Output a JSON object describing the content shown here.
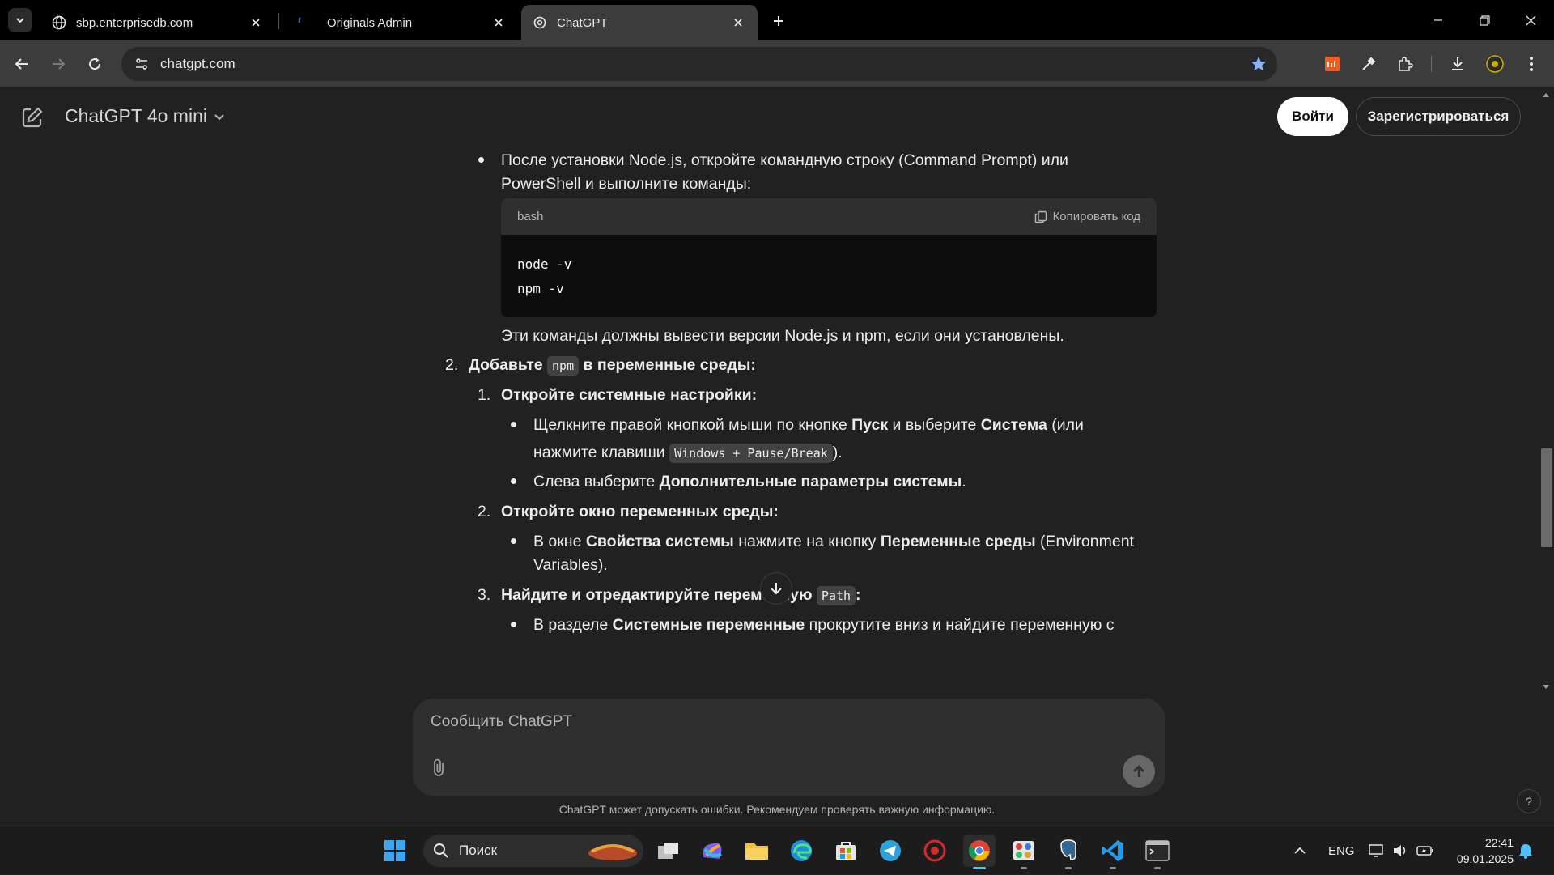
{
  "browser": {
    "tabs": [
      {
        "title": "sbp.enterprisedb.com",
        "active": false,
        "icon": "globe-icon"
      },
      {
        "title": "Originals Admin",
        "active": false,
        "icon": "page-icon"
      },
      {
        "title": "ChatGPT",
        "active": true,
        "icon": "openai-icon"
      }
    ],
    "url": "chatgpt.com"
  },
  "app": {
    "model_name": "ChatGPT 4o mini",
    "login_label": "Войти",
    "signup_label": "Зарегистрироваться",
    "composer_placeholder": "Сообщить ChatGPT",
    "disclaimer": "ChatGPT может допускать ошибки. Рекомендуем проверять важную информацию.",
    "help_label": "?"
  },
  "message": {
    "bullet_node_1": "После установки Node.js, откройте командную строку (Command Prompt) или",
    "bullet_node_2": "PowerShell и выполните команды:",
    "code": {
      "language": "bash",
      "copy_label": "Копировать код",
      "lines": [
        "node -v",
        "npm -v"
      ]
    },
    "after_code": "Эти команды должны вывести версии Node.js и npm, если они установлены.",
    "step2": {
      "num": "2.",
      "pre": "Добавьте",
      "code": "npm",
      "post": "в переменные среды:"
    },
    "sub1": {
      "num": "1.",
      "title": "Откройте системные настройки:"
    },
    "sub1_b1": {
      "t1": "Щелкните правой кнопкой мыши по кнопке ",
      "b1": "Пуск",
      "t2": " и выберите ",
      "b2": "Система",
      "t3": " (или",
      "t4": "нажмите клавиши ",
      "code": "Windows + Pause/Break",
      "t5": ")."
    },
    "sub1_b2": {
      "t1": "Слева выберите ",
      "b1": "Дополнительные параметры системы",
      "t2": "."
    },
    "sub2": {
      "num": "2.",
      "title": "Откройте окно переменных среды:"
    },
    "sub2_b1": {
      "t1": "В окне ",
      "b1": "Свойства системы",
      "t2": " нажмите на кнопку ",
      "b2": "Переменные среды",
      "t3": " (Environment",
      "t4": "Variables)."
    },
    "sub3": {
      "num": "3.",
      "title": "Найдите и отредактируйте переменную",
      "code": "Path",
      "colon": ":"
    },
    "sub3_b1": {
      "t1": "В разделе ",
      "b1": "Системные переменные",
      "t2": " прокрутите вниз и найдите переменную с"
    }
  },
  "taskbar": {
    "search_label": "Поиск",
    "lang": "ENG",
    "time": "22:41",
    "date": "09.01.2025",
    "apps": [
      "windows-start-icon",
      "task-view-icon",
      "copilot-icon",
      "file-explorer-icon",
      "edge-icon",
      "store-icon",
      "telegram-icon",
      "antivirus-icon",
      "chrome-icon",
      "paint-icon",
      "pgadmin-icon",
      "vscode-icon",
      "terminal-icon"
    ]
  }
}
